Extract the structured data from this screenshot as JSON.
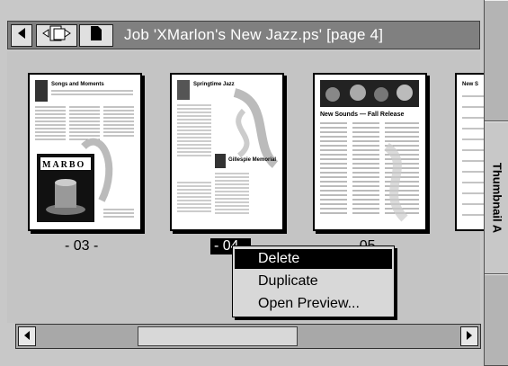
{
  "toolbar": {
    "job_title": "Job 'XMarlon's New Jazz.ps' [page 4]",
    "icons": [
      "triangle-left-icon",
      "multi-page-icon",
      "single-page-icon"
    ]
  },
  "thumbnails": [
    {
      "label": "- 03 -",
      "heading": "Songs and Moments",
      "art_text": "MARBO"
    },
    {
      "label": "- 04 -",
      "heading": "Springtime Jazz",
      "subheading": "Gillespie Memorial"
    },
    {
      "label": "- 05 -",
      "heading": "New Sounds — Fall Release"
    },
    {
      "label": "",
      "heading": "New S"
    }
  ],
  "context_menu": {
    "items": [
      "Delete",
      "Duplicate",
      "Open Preview..."
    ],
    "highlighted": "Delete"
  },
  "side_panel": {
    "tab_label": "Thumbnail A"
  }
}
